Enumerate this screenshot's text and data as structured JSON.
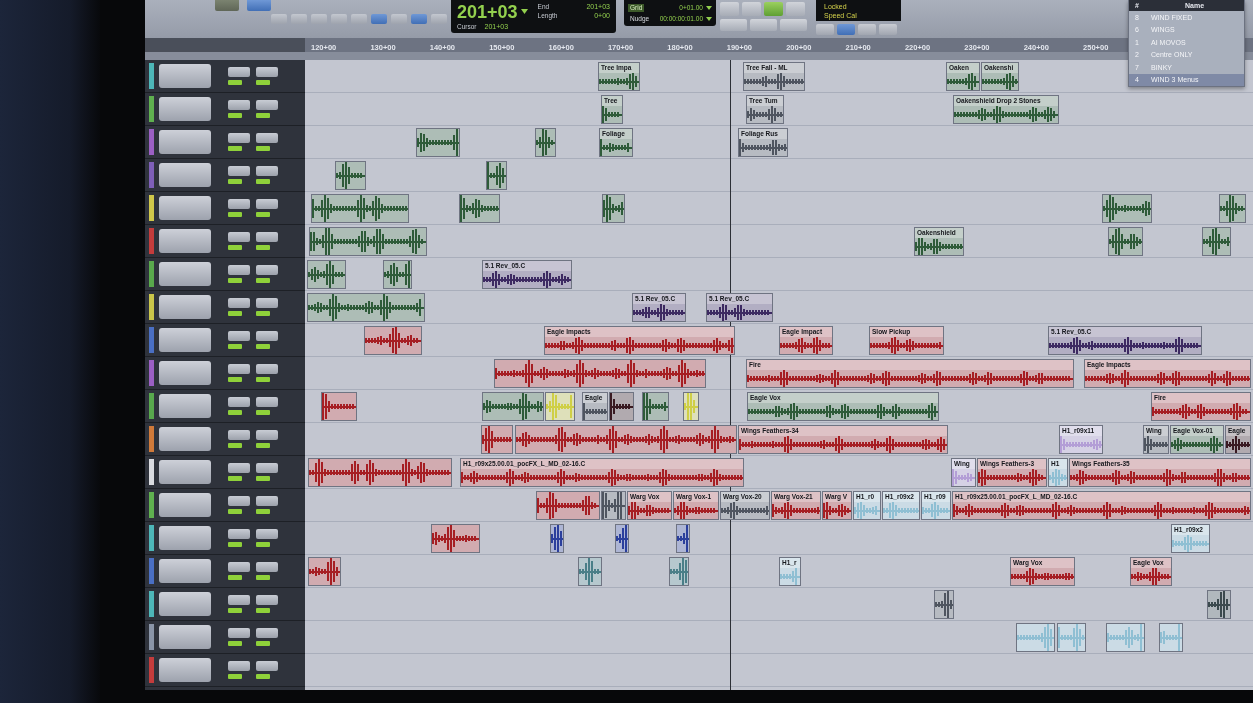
{
  "toolbar": {
    "mode_buttons": [
      {
        "selected": false
      },
      {
        "selected": true
      }
    ],
    "tool_buttons": [
      {
        "selected": false
      },
      {
        "selected": false
      },
      {
        "selected": false
      },
      {
        "selected": false
      },
      {
        "selected": false
      },
      {
        "selected": true
      },
      {
        "selected": false
      },
      {
        "selected": true
      },
      {
        "selected": false
      }
    ],
    "counter": {
      "main": "201+03",
      "fields": [
        {
          "label": "End",
          "value": "201+03"
        },
        {
          "label": "Length",
          "value": "0+00"
        }
      ],
      "cursor": {
        "label": "Cursor",
        "value": "201+03"
      }
    },
    "grid": {
      "label": "Grid",
      "value": "0+01.00"
    },
    "nudge": {
      "label": "Nudge",
      "value": "00:00:00:01.00"
    },
    "transport_buttons": [
      {
        "selected": false
      },
      {
        "selected": false
      },
      {
        "selected": true
      },
      {
        "selected": false
      },
      {
        "selected": false
      },
      {
        "selected": false
      },
      {
        "selected": false
      }
    ],
    "sync_status": [
      "Locked",
      "Speed Cal"
    ],
    "sync_buttons": [
      {
        "selected": false
      },
      {
        "selected": true
      },
      {
        "selected": false
      },
      {
        "selected": false
      }
    ]
  },
  "memory_locations": {
    "columns": [
      "#",
      "Name"
    ],
    "rows": [
      {
        "number": "8",
        "name": "WIND FIXED",
        "selected": false
      },
      {
        "number": "6",
        "name": "WINGS",
        "selected": false
      },
      {
        "number": "1",
        "name": "AI MOVOS",
        "selected": false
      },
      {
        "number": "2",
        "name": "Centre ONLY",
        "selected": false
      },
      {
        "number": "7",
        "name": "BINKY",
        "selected": false
      },
      {
        "number": "4",
        "name": "WIND 3 Menus",
        "selected": true
      }
    ]
  },
  "ruler": [
    "120+00",
    "130+00",
    "140+00",
    "150+00",
    "160+00",
    "170+00",
    "180+00",
    "190+00",
    "200+00",
    "210+00",
    "220+00",
    "230+00",
    "240+00",
    "250+00"
  ],
  "tracks": [
    {
      "color": "#4db6b8",
      "clips": [
        {
          "name": "Tree Impa",
          "color": "#2e5b39"
        },
        {
          "name": "Tree Fall - ML",
          "color": "#4f5560"
        },
        {
          "name": "Oaken",
          "color": "#2e5b39"
        },
        {
          "name": "Oakenshi",
          "color": "#2e5b39"
        }
      ]
    },
    {
      "color": "#5fb04f",
      "clips": [
        {
          "name": "Tree",
          "color": "#2e5b39"
        },
        {
          "name": "Tree Tum",
          "color": "#4f5560"
        },
        {
          "name": "Oakenshield Drop 2 Stones",
          "color": "#2e5b39"
        }
      ]
    },
    {
      "color": "#9b5fc4",
      "clips": [
        {
          "color": "#2e5b39"
        },
        {
          "color": "#2e5b39"
        },
        {
          "name": "Foliage",
          "color": "#2e5b39"
        },
        {
          "name": "Foliage Rus",
          "color": "#4f5560"
        }
      ]
    },
    {
      "color": "#7e5fb8",
      "clips": [
        {
          "color": "#2e5b39"
        },
        {
          "color": "#2e5b39"
        }
      ]
    },
    {
      "color": "#cfc74a",
      "clips": [
        {
          "color": "#2e5b39"
        },
        {
          "color": "#2e5b39"
        },
        {
          "color": "#2e5b39"
        },
        {
          "color": "#2e5b39"
        },
        {
          "color": "#2e5b39"
        }
      ]
    },
    {
      "color": "#c43c3c",
      "clips": [
        {
          "color": "#2e5b39"
        },
        {
          "name": "Oakenshield",
          "color": "#2e5b39"
        },
        {
          "color": "#2e5b39"
        },
        {
          "color": "#2e5b39"
        }
      ]
    },
    {
      "color": "#59a94c",
      "clips": [
        {
          "color": "#2e5b39"
        },
        {
          "color": "#2e5b39"
        },
        {
          "name": "5.1 Rev_05.C",
          "color": "#3d2a62"
        }
      ]
    },
    {
      "color": "#c9c54a",
      "clips": [
        {
          "color": "#2e5b39"
        },
        {
          "name": "5.1 Rev_05.C",
          "color": "#3d2a62"
        },
        {
          "name": "5.1 Rev_05.C",
          "color": "#3d2a62"
        }
      ]
    },
    {
      "color": "#4a6fc4",
      "clips": [
        {
          "color": "#a61e23"
        },
        {
          "name": "Eagle Impacts",
          "color": "#a61e23"
        },
        {
          "name": "Eagle Impact",
          "color": "#a61e23"
        },
        {
          "name": "Slow Pickup",
          "color": "#a61e23"
        },
        {
          "name": "5.1 Rev_05.C",
          "color": "#3d2a62"
        }
      ]
    },
    {
      "color": "#9b5fc4",
      "clips": [
        {
          "color": "#a61e23"
        },
        {
          "name": "Fire",
          "color": "#a61e23"
        },
        {
          "name": "Eagle Impacts",
          "color": "#a61e23"
        }
      ]
    },
    {
      "color": "#58a84d",
      "clips": [
        {
          "color": "#a61e23"
        },
        {
          "color": "#2e5b39"
        },
        {
          "color": "#cfcf46"
        },
        {
          "name": "Eagle",
          "color": "#4f5560"
        },
        {
          "color": "#3a1a22"
        },
        {
          "color": "#2e5b39"
        },
        {
          "color": "#cfcf46"
        },
        {
          "name": "Eagle Vox",
          "color": "#2e5b39"
        },
        {
          "name": "Fire",
          "color": "#a61e23"
        }
      ]
    },
    {
      "color": "#d07a3a",
      "clips": [
        {
          "color": "#a61e23"
        },
        {
          "color": "#a61e23"
        },
        {
          "name": "Wings Feathers-34",
          "color": "#a61e23"
        },
        {
          "name": "H1_r09x11",
          "color": "#b39ed6"
        },
        {
          "name": "Wing",
          "color": "#4f5560"
        },
        {
          "name": "Eagle Vox-01",
          "color": "#2e5b39"
        },
        {
          "name": "Eagle",
          "color": "#3a1a22"
        }
      ]
    },
    {
      "color": "#d9dbe0",
      "clips": [
        {
          "color": "#a61e23"
        },
        {
          "name": "H1_r09x25.00.01_pocFX_L_MD_02-16.C",
          "color": "#a61e23"
        },
        {
          "name": "Wing",
          "color": "#b39ed6"
        },
        {
          "name": "Wings Feathers-3",
          "color": "#a61e23"
        },
        {
          "name": "H1",
          "color": "#8fbfd3"
        },
        {
          "name": "Wings Feathers-35",
          "color": "#a61e23"
        }
      ]
    },
    {
      "color": "#5fb04f",
      "clips": [
        {
          "color": "#a61e23"
        },
        {
          "color": "#4f5560"
        },
        {
          "name": "Warg Vox",
          "color": "#a61e23"
        },
        {
          "name": "Warg Vox-1",
          "color": "#a61e23"
        },
        {
          "name": "Warg Vox-20",
          "color": "#4f5560"
        },
        {
          "name": "Warg Vox-21",
          "color": "#a61e23"
        },
        {
          "name": "Warg V",
          "color": "#a61e23"
        },
        {
          "name": "H1_r0",
          "color": "#8fbfd3"
        },
        {
          "name": "H1_r09x2",
          "color": "#8fbfd3"
        },
        {
          "name": "H1_r09",
          "color": "#8fbfd3"
        },
        {
          "name": "H1_r09x25.00.01_pocFX_L_MD_02-16.C",
          "color": "#a61e23"
        }
      ]
    },
    {
      "color": "#4db6b8",
      "clips": [
        {
          "color": "#a61e23"
        },
        {
          "color": "#2b3f9c"
        },
        {
          "color": "#2b3f9c"
        },
        {
          "color": "#2b3f9c"
        },
        {
          "name": "H1_r09x2",
          "color": "#8fbfd3"
        }
      ]
    },
    {
      "color": "#4a6fc4",
      "clips": [
        {
          "color": "#a61e23"
        },
        {
          "color": "#4a7f88"
        },
        {
          "color": "#4a7f88"
        },
        {
          "name": "H1_r",
          "color": "#8fbfd3"
        },
        {
          "name": "Warg Vox",
          "color": "#a61e23"
        },
        {
          "name": "Eagle Vox",
          "color": "#a61e23"
        }
      ]
    },
    {
      "color": "#4db6b8",
      "clips": [
        {
          "color": "#4f5560"
        },
        {
          "color": "#3b4a4e"
        }
      ]
    },
    {
      "color": "#8a95a8",
      "clips": [
        {
          "color": "#8fbfd3"
        },
        {
          "color": "#8fbfd3"
        },
        {
          "color": "#8fbfd3"
        },
        {
          "color": "#8fbfd3"
        }
      ]
    },
    {
      "color": "#c43c3c"
    }
  ]
}
